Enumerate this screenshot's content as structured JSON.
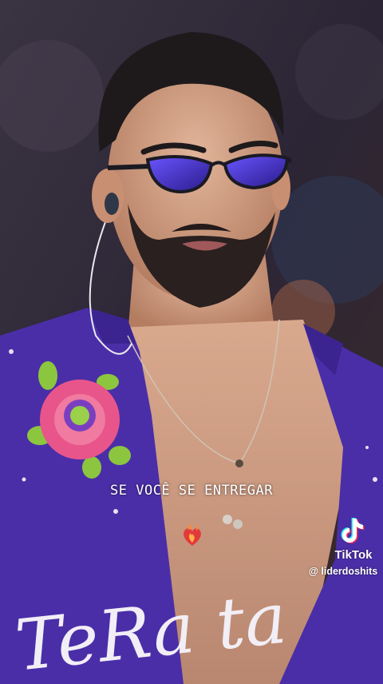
{
  "video": {
    "caption": "SE VOCÊ SE ENTREGAR",
    "shirt_text": "TeRa ta",
    "reaction_icon": "heart-on-fire-icon"
  },
  "watermark": {
    "brand": "TikTok",
    "handle": "@ liderdoshits",
    "logo_icon": "tiktok-logo-icon"
  },
  "colors": {
    "shirt": "#4a2ea8",
    "background": "#2a2436",
    "lens": "#4b2fd6",
    "flower": "#e8558a"
  }
}
